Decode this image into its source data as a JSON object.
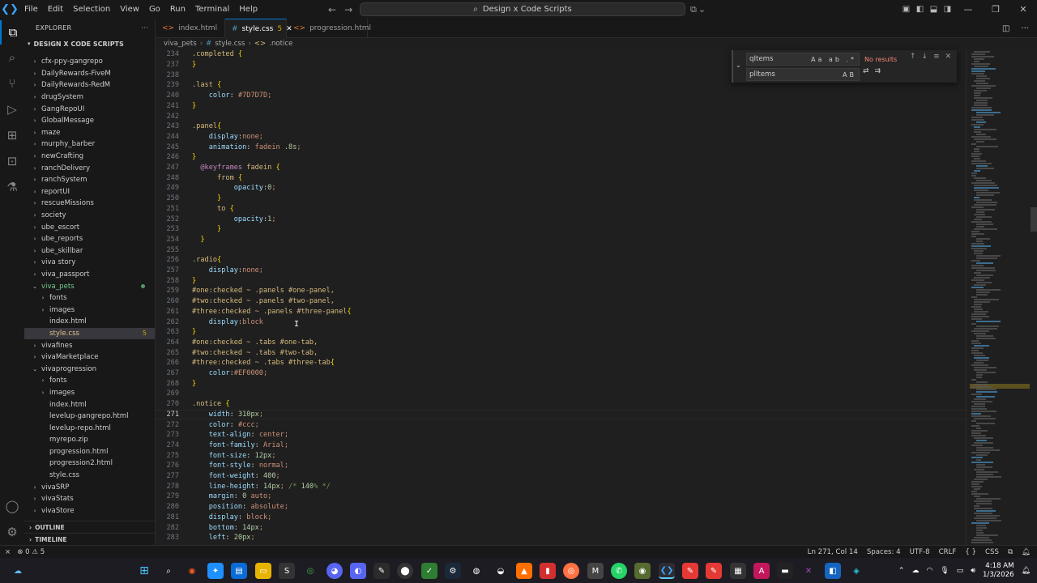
{
  "titlebar": {
    "menu": [
      "File",
      "Edit",
      "Selection",
      "View",
      "Go",
      "Run",
      "Terminal",
      "Help"
    ],
    "command_center": "Design x Code Scripts"
  },
  "sidebar": {
    "title": "EXPLORER",
    "workspace": "DESIGN X CODE SCRIPTS",
    "items": [
      {
        "label": "cfx-ppy-gangrepo",
        "type": "folder",
        "depth": 1
      },
      {
        "label": "DailyRewards-FiveM",
        "type": "folder",
        "depth": 1
      },
      {
        "label": "DailyRewards-RedM",
        "type": "folder",
        "depth": 1
      },
      {
        "label": "drugSystem",
        "type": "folder",
        "depth": 1
      },
      {
        "label": "GangRepoUI",
        "type": "folder",
        "depth": 1
      },
      {
        "label": "GlobalMessage",
        "type": "folder",
        "depth": 1
      },
      {
        "label": "maze",
        "type": "folder",
        "depth": 1
      },
      {
        "label": "murphy_barber",
        "type": "folder",
        "depth": 1
      },
      {
        "label": "newCrafting",
        "type": "folder",
        "depth": 1
      },
      {
        "label": "ranchDelivery",
        "type": "folder",
        "depth": 1
      },
      {
        "label": "ranchSystem",
        "type": "folder",
        "depth": 1
      },
      {
        "label": "reportUI",
        "type": "folder",
        "depth": 1
      },
      {
        "label": "rescueMissions",
        "type": "folder",
        "depth": 1
      },
      {
        "label": "society",
        "type": "folder",
        "depth": 1
      },
      {
        "label": "ube_escort",
        "type": "folder",
        "depth": 1
      },
      {
        "label": "ube_reports",
        "type": "folder",
        "depth": 1
      },
      {
        "label": "ube_skillbar",
        "type": "folder",
        "depth": 1
      },
      {
        "label": "viva story",
        "type": "folder",
        "depth": 1
      },
      {
        "label": "viva_passport",
        "type": "folder",
        "depth": 1
      },
      {
        "label": "viva_pets",
        "type": "folder-open",
        "depth": 1,
        "status": "mod"
      },
      {
        "label": "fonts",
        "type": "folder",
        "depth": 2
      },
      {
        "label": "images",
        "type": "folder",
        "depth": 2
      },
      {
        "label": "index.html",
        "type": "file",
        "depth": 2
      },
      {
        "label": "style.css",
        "type": "file",
        "depth": 2,
        "selected": true,
        "badge": "5"
      },
      {
        "label": "vivafines",
        "type": "folder",
        "depth": 1
      },
      {
        "label": "vivaMarketplace",
        "type": "folder",
        "depth": 1
      },
      {
        "label": "vivaprogression",
        "type": "folder-open",
        "depth": 1
      },
      {
        "label": "fonts",
        "type": "folder",
        "depth": 2
      },
      {
        "label": "images",
        "type": "folder",
        "depth": 2
      },
      {
        "label": "index.html",
        "type": "file",
        "depth": 2
      },
      {
        "label": "levelup-gangrepo.html",
        "type": "file",
        "depth": 2
      },
      {
        "label": "levelup-repo.html",
        "type": "file",
        "depth": 2
      },
      {
        "label": "myrepo.zip",
        "type": "file",
        "depth": 2
      },
      {
        "label": "progression.html",
        "type": "file",
        "depth": 2
      },
      {
        "label": "progression2.html",
        "type": "file",
        "depth": 2
      },
      {
        "label": "style.css",
        "type": "file",
        "depth": 2
      },
      {
        "label": "vivaSRP",
        "type": "folder",
        "depth": 1
      },
      {
        "label": "vivaStats",
        "type": "folder",
        "depth": 1
      },
      {
        "label": "vivaStore",
        "type": "folder",
        "depth": 1
      }
    ],
    "outline": "OUTLINE",
    "timeline": "TIMELINE"
  },
  "tabs": [
    {
      "label": "index.html",
      "active": false
    },
    {
      "label": "style.css",
      "active": true,
      "badge": "5"
    },
    {
      "label": "progression.html",
      "active": false
    }
  ],
  "breadcrumb": [
    "viva_pets",
    "style.css",
    ".notice"
  ],
  "find": {
    "query": "qItems",
    "result": "No results",
    "replace": "plItems"
  },
  "editor": {
    "lines": [
      {
        "n": "234",
        "code": ".completed {",
        "type": "partial"
      },
      {
        "n": "237",
        "code": "}"
      },
      {
        "n": "238",
        "code": ""
      },
      {
        "n": "239",
        "code": ".last {"
      },
      {
        "n": "240",
        "code": "    color: #7D7D7D;",
        "swatch": "#7D7D7D"
      },
      {
        "n": "241",
        "code": "}"
      },
      {
        "n": "242",
        "code": ""
      },
      {
        "n": "243",
        "code": ".panel{"
      },
      {
        "n": "244",
        "code": "    display:none;"
      },
      {
        "n": "245",
        "code": "    animation: fadein .8s;"
      },
      {
        "n": "246",
        "code": "}"
      },
      {
        "n": "247",
        "code": "  @keyframes fadein {"
      },
      {
        "n": "248",
        "code": "      from {"
      },
      {
        "n": "249",
        "code": "          opacity:0;"
      },
      {
        "n": "250",
        "code": "      }"
      },
      {
        "n": "251",
        "code": "      to {"
      },
      {
        "n": "252",
        "code": "          opacity:1;"
      },
      {
        "n": "253",
        "code": "      }"
      },
      {
        "n": "254",
        "code": "  }"
      },
      {
        "n": "255",
        "code": ""
      },
      {
        "n": "256",
        "code": ".radio{"
      },
      {
        "n": "257",
        "code": "    display:none;"
      },
      {
        "n": "258",
        "code": "}"
      },
      {
        "n": "259",
        "code": "#one:checked ~ .panels #one-panel,"
      },
      {
        "n": "260",
        "code": "#two:checked ~ .panels #two-panel,"
      },
      {
        "n": "261",
        "code": "#three:checked ~ .panels #three-panel{"
      },
      {
        "n": "262",
        "code": "    display:block"
      },
      {
        "n": "263",
        "code": "}"
      },
      {
        "n": "264",
        "code": "#one:checked ~ .tabs #one-tab,"
      },
      {
        "n": "265",
        "code": "#two:checked ~ .tabs #two-tab,"
      },
      {
        "n": "266",
        "code": "#three:checked ~ .tabs #three-tab{"
      },
      {
        "n": "267",
        "code": "    color:#EF0000;",
        "swatch": "#EF0000"
      },
      {
        "n": "268",
        "code": "}"
      },
      {
        "n": "269",
        "code": ""
      },
      {
        "n": "270",
        "code": ".notice {"
      },
      {
        "n": "271",
        "code": "    width: 310px;",
        "current": true
      },
      {
        "n": "272",
        "code": "    color: #ccc;",
        "swatch": "#cccccc"
      },
      {
        "n": "273",
        "code": "    text-align: center;"
      },
      {
        "n": "274",
        "code": "    font-family: Arial;"
      },
      {
        "n": "275",
        "code": "    font-size: 12px;"
      },
      {
        "n": "276",
        "code": "    font-style: normal;"
      },
      {
        "n": "277",
        "code": "    font-weight: 400;"
      },
      {
        "n": "278",
        "code": "    line-height: 14px; /* 140% */"
      },
      {
        "n": "279",
        "code": "    margin: 0 auto;"
      },
      {
        "n": "280",
        "code": "    position: absolute;"
      },
      {
        "n": "281",
        "code": "    display: block;"
      },
      {
        "n": "282",
        "code": "    bottom: 14px;"
      },
      {
        "n": "283",
        "code": "    left: 20px;"
      }
    ]
  },
  "statusbar": {
    "errors": "0",
    "warnings": "5",
    "position": "Ln 271, Col 14",
    "spaces": "Spaces: 4",
    "encoding": "UTF-8",
    "eol": "CRLF",
    "language": "CSS"
  },
  "taskbar": {
    "time": "4:18 AM",
    "date": "1/3/2026"
  }
}
